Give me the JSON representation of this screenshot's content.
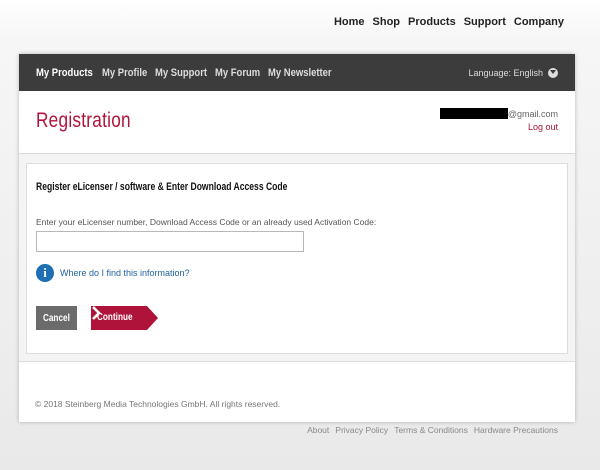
{
  "top_nav": [
    "Home",
    "Shop",
    "Products",
    "Support",
    "Company"
  ],
  "sub_nav": {
    "items": [
      "My Products",
      "My Profile",
      "My Support",
      "My Forum",
      "My Newsletter"
    ],
    "language": "Language: English"
  },
  "header": {
    "title": "Registration",
    "email_suffix": "@gmail.com",
    "logout": "Log out"
  },
  "form": {
    "title": "Register eLicenser / software & Enter Download Access Code",
    "label": "Enter your eLicenser number, Download Access Code or an already used Activation Code:",
    "input_value": "",
    "info_link": "Where do I find this information?",
    "cancel": "Cancel",
    "continue": "Continue"
  },
  "footer": {
    "copyright": "© 2018 Steinberg Media Technologies GmbH. All rights reserved.",
    "links": [
      "About",
      "Privacy Policy",
      "Terms & Conditions",
      "Hardware Precautions"
    ]
  },
  "colors": {
    "accent": "#b0133a",
    "nav_bar": "#3c3c3c",
    "info": "#1f6fb5"
  }
}
